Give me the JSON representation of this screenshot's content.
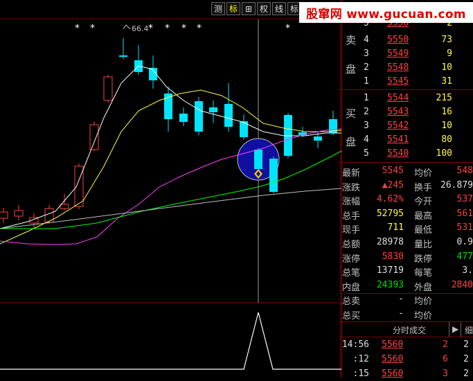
{
  "toolbar": {
    "buttons": [
      {
        "label": "测",
        "active": false
      },
      {
        "label": "标",
        "active": true
      },
      {
        "label": "⊞",
        "active": false
      },
      {
        "label": "权",
        "active": false
      },
      {
        "label": "线",
        "active": false
      },
      {
        "label": "标",
        "active": false
      }
    ]
  },
  "watermark": "股窜网 www.gucuan.com",
  "chart": {
    "annotation": "66.4",
    "star_markers": "*  *        *  *  *  *                    *",
    "colors": {
      "up": "#ff4040",
      "down": "#00e5ff",
      "ma1": "#ffffff",
      "ma2": "#ffff40",
      "ma3": "#ff40ff",
      "ma4": "#00ff00",
      "ma5": "#c0c0c0",
      "highlight": "#1a1aa0"
    }
  },
  "order_book": {
    "sell_label_1": "卖",
    "sell_label_2": "盘",
    "buy_label_1": "买",
    "buy_label_2": "盘",
    "sells": [
      {
        "level": "5",
        "price": "5550",
        "vol": "2"
      },
      {
        "level": "4",
        "price": "5550",
        "vol": "73"
      },
      {
        "level": "3",
        "price": "5549",
        "vol": "9"
      },
      {
        "level": "2",
        "price": "5548",
        "vol": "10"
      },
      {
        "level": "1",
        "price": "5545",
        "vol": "31"
      }
    ],
    "buys": [
      {
        "level": "1",
        "price": "5544",
        "vol": "215"
      },
      {
        "level": "2",
        "price": "5543",
        "vol": "16"
      },
      {
        "level": "3",
        "price": "5542",
        "vol": "10"
      },
      {
        "level": "4",
        "price": "5541",
        "vol": "80"
      },
      {
        "level": "5",
        "price": "5540",
        "vol": "100"
      }
    ]
  },
  "quote": [
    {
      "l1": "最新",
      "v1": "5545",
      "c1": "red",
      "l2": "均价",
      "v2": "548",
      "c2": "red"
    },
    {
      "l1": "涨跌",
      "v1": "▲245",
      "c1": "red",
      "l2": "换手",
      "v2": "26.879",
      "c2": "white"
    },
    {
      "l1": "涨幅",
      "v1": "4.62%",
      "c1": "red",
      "l2": "今开",
      "v2": "537",
      "c2": "red"
    },
    {
      "l1": "总手",
      "v1": "52795",
      "c1": "yellow",
      "l2": "最高",
      "v2": "561",
      "c2": "red"
    },
    {
      "l1": "现手",
      "v1": "711",
      "c1": "yellow",
      "l2": "最低",
      "v2": "531",
      "c2": "red"
    },
    {
      "l1": "总额",
      "v1": "28978",
      "c1": "white",
      "l2": "量比",
      "v2": "0.9",
      "c2": "white"
    },
    {
      "l1": "涨停",
      "v1": "5830",
      "c1": "red",
      "l2": "跌停",
      "v2": "477",
      "c2": "green"
    },
    {
      "l1": "总笔",
      "v1": "13719",
      "c1": "white",
      "l2": "每笔",
      "v2": "3.",
      "c2": "white"
    },
    {
      "l1": "内盘",
      "v1": "24393",
      "c1": "green",
      "l2": "外盘",
      "v2": "2840",
      "c2": "red"
    },
    {
      "l1": "总卖",
      "v1": "-",
      "c1": "white",
      "l2": "均价",
      "v2": "",
      "c2": "white"
    },
    {
      "l1": "总买",
      "v1": "-",
      "c1": "white",
      "l2": "均价",
      "v2": "",
      "c2": "white"
    }
  ],
  "tabs": {
    "ticks": "分时成交",
    "arrow": "▶",
    "detail": "细"
  },
  "ticks": [
    {
      "time": "14:56",
      "price": "5560",
      "vol": "2",
      "num": "2"
    },
    {
      "time": ":12",
      "price": "5560",
      "vol": "6",
      "num": "2"
    },
    {
      "time": ":15",
      "price": "5560",
      "vol": "3",
      "num": "2"
    }
  ]
}
